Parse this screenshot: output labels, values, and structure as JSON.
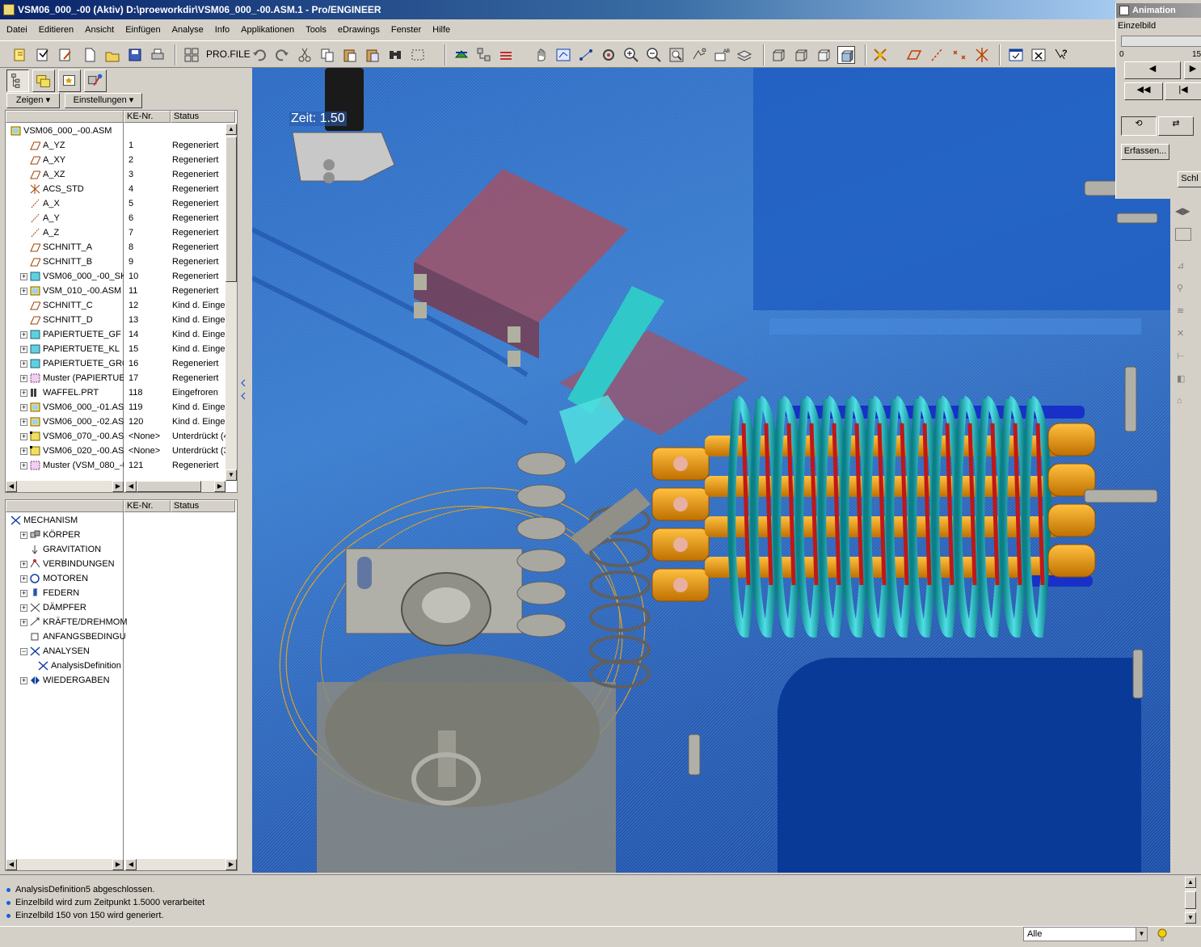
{
  "window": {
    "title": "VSM06_000_-00 (Aktiv) D:\\proeworkdir\\VSM06_000_-00.ASM.1 - Pro/ENGINEER"
  },
  "menu": [
    "Datei",
    "Editieren",
    "Ansicht",
    "Einfügen",
    "Analyse",
    "Info",
    "Applikationen",
    "Tools",
    "eDrawings",
    "Fenster",
    "Hilfe"
  ],
  "toolbar": {
    "profile_label": "PRO.FILE"
  },
  "panel": {
    "show_btn": "Zeigen",
    "settings_btn": "Einstellungen",
    "col_ke": "KE-Nr.",
    "col_status": "Status"
  },
  "tree1": [
    {
      "name": "VSM06_000_-00.ASM",
      "ke": "",
      "status": "",
      "icon": "assembly",
      "exp": false,
      "indent": 0
    },
    {
      "name": "A_YZ",
      "ke": "1",
      "status": "Regeneriert",
      "icon": "datum-plane",
      "exp": false,
      "indent": 1
    },
    {
      "name": "A_XY",
      "ke": "2",
      "status": "Regeneriert",
      "icon": "datum-plane",
      "exp": false,
      "indent": 1
    },
    {
      "name": "A_XZ",
      "ke": "3",
      "status": "Regeneriert",
      "icon": "datum-plane",
      "exp": false,
      "indent": 1
    },
    {
      "name": "ACS_STD",
      "ke": "4",
      "status": "Regeneriert",
      "icon": "csys",
      "exp": false,
      "indent": 1
    },
    {
      "name": "A_X",
      "ke": "5",
      "status": "Regeneriert",
      "icon": "axis",
      "exp": false,
      "indent": 1
    },
    {
      "name": "A_Y",
      "ke": "6",
      "status": "Regeneriert",
      "icon": "axis",
      "exp": false,
      "indent": 1
    },
    {
      "name": "A_Z",
      "ke": "7",
      "status": "Regeneriert",
      "icon": "axis",
      "exp": false,
      "indent": 1
    },
    {
      "name": "SCHNITT_A",
      "ke": "8",
      "status": "Regeneriert",
      "icon": "datum-plane",
      "exp": false,
      "indent": 1
    },
    {
      "name": "SCHNITT_B",
      "ke": "9",
      "status": "Regeneriert",
      "icon": "datum-plane",
      "exp": false,
      "indent": 1
    },
    {
      "name": "VSM06_000_-00_SK",
      "ke": "10",
      "status": "Regeneriert",
      "icon": "part",
      "exp": true,
      "indent": 1
    },
    {
      "name": "VSM_010_-00.ASM",
      "ke": "11",
      "status": "Regeneriert",
      "icon": "assembly",
      "exp": true,
      "indent": 1
    },
    {
      "name": "SCHNITT_C",
      "ke": "12",
      "status": "Kind d. Einge:",
      "icon": "datum-plane",
      "exp": false,
      "indent": 1
    },
    {
      "name": "SCHNITT_D",
      "ke": "13",
      "status": "Kind d. Einge:",
      "icon": "datum-plane",
      "exp": false,
      "indent": 1
    },
    {
      "name": "PAPIERTUETE_GF",
      "ke": "14",
      "status": "Kind d. Einge:",
      "icon": "part",
      "exp": true,
      "indent": 1
    },
    {
      "name": "PAPIERTUETE_KL",
      "ke": "15",
      "status": "Kind d. Einge:",
      "icon": "part",
      "exp": true,
      "indent": 1
    },
    {
      "name": "PAPIERTUETE_GRO",
      "ke": "16",
      "status": "Regeneriert",
      "icon": "part",
      "exp": true,
      "indent": 1
    },
    {
      "name": "Muster (PAPIERTUE",
      "ke": "17",
      "status": "Regeneriert",
      "icon": "pattern",
      "exp": true,
      "indent": 1
    },
    {
      "name": "WAFFEL.PRT",
      "ke": "118",
      "status": "Eingefroren",
      "icon": "part-frozen",
      "exp": true,
      "indent": 1
    },
    {
      "name": "VSM06_000_-01.AS",
      "ke": "119",
      "status": "Kind d. Einge:",
      "icon": "assembly",
      "exp": true,
      "indent": 1
    },
    {
      "name": "VSM06_000_-02.AS",
      "ke": "120",
      "status": "Kind d. Einge:",
      "icon": "assembly",
      "exp": true,
      "indent": 1
    },
    {
      "name": "VSM06_070_-00.AS",
      "ke": "<None>",
      "status": "Unterdrückt (4",
      "icon": "assembly-suppressed",
      "exp": true,
      "indent": 1
    },
    {
      "name": "VSM06_020_-00.AS",
      "ke": "<None>",
      "status": "Unterdrückt (3",
      "icon": "assembly-suppressed",
      "exp": true,
      "indent": 1
    },
    {
      "name": "Muster (VSM_080_-0",
      "ke": "121",
      "status": "Regeneriert",
      "icon": "pattern",
      "exp": true,
      "indent": 1
    }
  ],
  "tree2": [
    {
      "name": "MECHANISM",
      "icon": "mechanism",
      "exp": false,
      "indent": 0
    },
    {
      "name": "KÖRPER",
      "icon": "bodies",
      "exp": true,
      "indent": 1
    },
    {
      "name": "GRAVITATION",
      "icon": "gravity",
      "exp": false,
      "indent": 1
    },
    {
      "name": "VERBINDUNGEN",
      "icon": "connections",
      "exp": true,
      "indent": 1
    },
    {
      "name": "MOTOREN",
      "icon": "motors",
      "exp": true,
      "indent": 1
    },
    {
      "name": "FEDERN",
      "icon": "springs",
      "exp": true,
      "indent": 1
    },
    {
      "name": "DÄMPFER",
      "icon": "dampers",
      "exp": true,
      "indent": 1
    },
    {
      "name": "KRÄFTE/DREHMOM",
      "icon": "forces",
      "exp": true,
      "indent": 1
    },
    {
      "name": "ANFANGSBEDINGU",
      "icon": "initial-conditions",
      "exp": false,
      "indent": 1
    },
    {
      "name": "ANALYSEN",
      "icon": "analyses",
      "exp": "open",
      "indent": 1
    },
    {
      "name": "AnalysisDefinition",
      "icon": "analysis-def",
      "exp": false,
      "indent": 2
    },
    {
      "name": "WIEDERGABEN",
      "icon": "playbacks",
      "exp": true,
      "indent": 1
    }
  ],
  "viewport": {
    "time_label": "Zeit: 1.50",
    "bg_color": "#2d6bc4"
  },
  "animation": {
    "title": "Animation",
    "frame_label": "Einzelbild",
    "slider_min": "0",
    "slider_max": "15",
    "capture_btn": "Erfassen...",
    "close_btn": "Schl"
  },
  "messages": [
    "AnalysisDefinition5 abgeschlossen.",
    "Einzelbild wird zum Zeitpunkt 1.5000 verarbeitet",
    "Einzelbild 150 von 150 wird generiert."
  ],
  "status": {
    "filter_value": "Alle"
  }
}
